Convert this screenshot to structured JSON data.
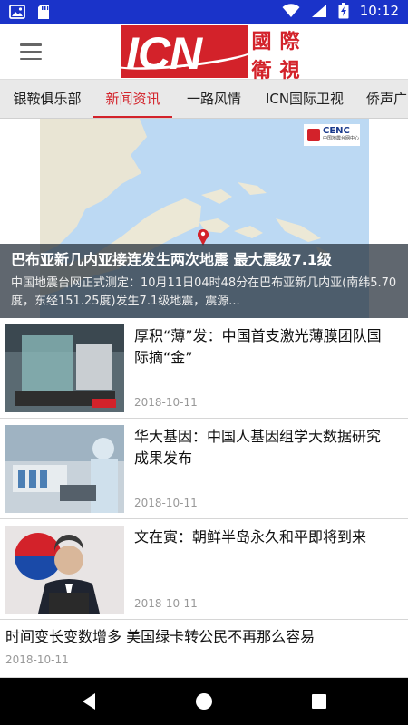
{
  "status_bar": {
    "time": "10:12",
    "icons": [
      "photo-icon",
      "sd-card-icon",
      "wifi-icon",
      "signal-icon",
      "battery-charging-icon"
    ]
  },
  "header": {
    "menu_icon": "hamburger-icon",
    "logo": {
      "letters": "ICN",
      "chars": [
        "國",
        "際",
        "衛",
        "視"
      ]
    }
  },
  "tabs": [
    {
      "label": "银鞍俱乐部",
      "active": false
    },
    {
      "label": "新闻资讯",
      "active": true
    },
    {
      "label": "一路风情",
      "active": false
    },
    {
      "label": "ICN国际卫视",
      "active": false
    },
    {
      "label": "侨声广",
      "active": false
    }
  ],
  "hero": {
    "title": "巴布亚新几内亚接连发生两次地震 最大震级7.1级",
    "summary": "中国地震台网正式测定：10月11日04时48分在巴布亚新几内亚(南纬5.70度，东经151.25度)发生7.1级地震，震源...",
    "map_badge": "CENC",
    "map_badge_sub": "中国地震台网中心"
  },
  "news": [
    {
      "title": "厚积“薄”发：中国首支激光薄膜团队国际摘“金”",
      "date": "2018-10-11",
      "thumb": "lab-equipment"
    },
    {
      "title": "华大基因：中国人基因组学大数据研究成果发布",
      "date": "2018-10-11",
      "thumb": "lab-researcher"
    },
    {
      "title": "文在寅：朝鲜半岛永久和平即将到来",
      "date": "2018-10-11",
      "thumb": "speaker-portrait"
    }
  ],
  "text_news": [
    {
      "title": "时间变长变数增多 美国绿卡转公民不再那么容易",
      "date": "2018-10-11"
    }
  ],
  "colors": {
    "status_bar": "#1a33c9",
    "accent": "#d3222a"
  }
}
